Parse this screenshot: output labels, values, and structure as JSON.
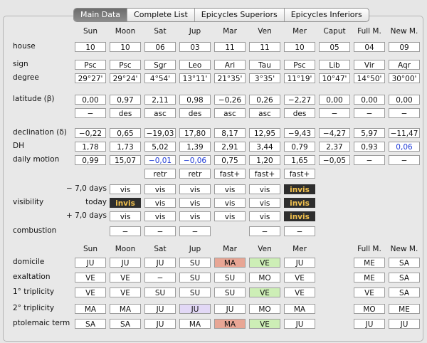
{
  "tabs": [
    {
      "label": "Main Data",
      "active": true
    },
    {
      "label": "Complete List",
      "active": false
    },
    {
      "label": "Epicycles Superiors",
      "active": false
    },
    {
      "label": "Epicycles Inferiors",
      "active": false
    }
  ],
  "columns": [
    "Sun",
    "Moon",
    "Sat",
    "Jup",
    "Mar",
    "Ven",
    "Mer",
    "Caput",
    "Full M.",
    "New M."
  ],
  "columns2": [
    "Sun",
    "Moon",
    "Sat",
    "Jup",
    "Mar",
    "Ven",
    "Mer",
    "Full M.",
    "New M."
  ],
  "labels": {
    "house": "house",
    "sign": "sign",
    "degree": "degree",
    "latitude": "latitude (β)",
    "declination": "declination (δ)",
    "dh": "DH",
    "daily": "daily motion",
    "minus": "− 7,0 days",
    "visibility": "visibility",
    "today": "today",
    "plus": "+ 7,0 days",
    "combustion": "combustion",
    "domicile": "domicile",
    "exaltation": "exaltation",
    "trip1": "1° triplicity",
    "trip2": "2° triplicity",
    "ptol": "ptolemaic term"
  },
  "house": [
    "10",
    "10",
    "06",
    "03",
    "11",
    "11",
    "10",
    "05",
    "04",
    "09"
  ],
  "sign": [
    "Psc",
    "Psc",
    "Sgr",
    "Leo",
    "Ari",
    "Tau",
    "Psc",
    "Lib",
    "Vir",
    "Aqr"
  ],
  "degree": [
    "29°27'",
    "29°24'",
    "4°54'",
    "13°11'",
    "21°35'",
    "3°35'",
    "11°19'",
    "10°47'",
    "14°50'",
    "30°00'"
  ],
  "latitude": [
    "0,00",
    "0,97",
    "2,11",
    "0,98",
    "−0,26",
    "0,26",
    "−2,27",
    "0,00",
    "0,00",
    "0,00"
  ],
  "latdir": [
    "−",
    "des",
    "asc",
    "des",
    "asc",
    "asc",
    "des",
    "−",
    "−",
    "−"
  ],
  "declination": [
    "−0,22",
    "0,65",
    "−19,03",
    "17,80",
    "8,17",
    "12,95",
    "−9,43",
    "−4,27",
    "5,97",
    "−11,47"
  ],
  "dh": [
    "1,78",
    "1,73",
    "5,02",
    "1,39",
    "2,91",
    "3,44",
    "0,79",
    "2,37",
    "0,93",
    "0,06"
  ],
  "daily": [
    "0,99",
    "15,07",
    "−0,01",
    "−0,06",
    "0,75",
    "1,20",
    "1,65",
    "−0,05",
    "−",
    "−"
  ],
  "motion": [
    "retr",
    "retr",
    "fast+",
    "fast+",
    "fast+"
  ],
  "vis_minus": [
    "vis",
    "vis",
    "vis",
    "vis",
    "vis",
    "invis"
  ],
  "vis_today": [
    "invis",
    "vis",
    "vis",
    "vis",
    "vis",
    "invis"
  ],
  "vis_plus": [
    "vis",
    "vis",
    "vis",
    "vis",
    "vis",
    "invis"
  ],
  "combustion": [
    "−",
    "−",
    "−",
    "−",
    "−"
  ],
  "domicile": [
    "JU",
    "JU",
    "JU",
    "SU",
    "MA",
    "VE",
    "JU",
    "ME",
    "SA"
  ],
  "exaltation": [
    "VE",
    "VE",
    "−",
    "SU",
    "SU",
    "MO",
    "VE",
    "ME",
    "SA"
  ],
  "trip1": [
    "VE",
    "VE",
    "SU",
    "SU",
    "SU",
    "VE",
    "VE",
    "VE",
    "SA"
  ],
  "trip2": [
    "MA",
    "MA",
    "JU",
    "JU",
    "JU",
    "MO",
    "MA",
    "MO",
    "ME"
  ],
  "ptol": [
    "SA",
    "SA",
    "JU",
    "MA",
    "MA",
    "VE",
    "JU",
    "JU",
    "JU"
  ],
  "colors": {
    "invis_bg": "#2e2e2e",
    "invis_text": "#f2c14e",
    "mars_red": "#e8a695",
    "venus_green": "#cdeeb6",
    "jupiter_lavender": "#e2d8f6",
    "blue_text": "#1f3bd6"
  }
}
